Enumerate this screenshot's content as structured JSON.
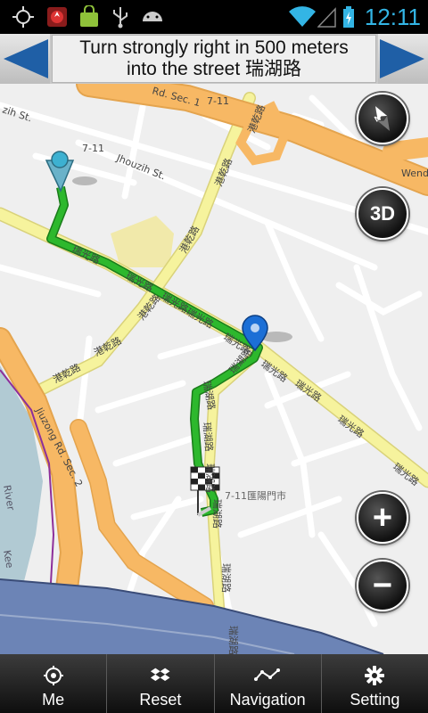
{
  "status_bar": {
    "clock": "12:11",
    "accent_color": "#33b5e5",
    "icons": [
      "gps-icon",
      "app-icon",
      "shopping-bag-icon",
      "usb-icon",
      "android-icon",
      "wifi-icon",
      "signal-icon",
      "battery-charging-icon"
    ]
  },
  "instruction": {
    "line1": "Turn strongly right in 500 meters",
    "line2": "into the street 瑞湖路"
  },
  "map": {
    "labels": {
      "rd_sec1": "Rd. Sec. 1",
      "seven_eleven_top": "7-11",
      "zih_st": "zih St.",
      "jhouzih_st": "Jhouzih St.",
      "seven_eleven_left": "7-11",
      "wende": "Wende",
      "gangqian_1": "港乾路",
      "gangqian_2": "港乾路",
      "gangqian_3": "港乾路",
      "gangqian_4": "港乾路",
      "gangqian_5": "港乾路",
      "ruiguang_1": "瑞光路",
      "ruiguang_2": "瑞光路",
      "ruiguang_3": "瑞光路",
      "ruiguang_4": "瑞光路",
      "ruiguang_5": "瑞光路",
      "ruiguang_6": "瑞光路",
      "ruiguang_7": "瑞光路",
      "ruiguang_8": "瑞光路",
      "ruiguang_9": "瑞光路",
      "ruihu_1": "瑞湖路",
      "ruihu_2": "瑞湖路",
      "ruihu_3": "瑞湖路",
      "ruihu_4": "瑞湖路",
      "ruihu_5": "瑞湖路",
      "ruihu_6": "瑞湖路",
      "ruihu_7": "瑞湖路",
      "jiuzong": "Jiuzong Rd. Sec. 2",
      "store": "7-11匯陽門市",
      "river": "River",
      "kee": "Kee"
    },
    "buttons": {
      "three_d": "3D",
      "zoom_in": "+",
      "zoom_out": "−"
    },
    "colors": {
      "route": "#2db82d",
      "major_road": "#f7b864",
      "secondary_road": "#f6f39d",
      "park": "#f1e9aa",
      "water": "#b1cad3",
      "highway": "#6c84b6",
      "marker": "#1c6fd6"
    }
  },
  "bottom_bar": {
    "tabs": [
      {
        "label": "Me",
        "icon": "crosshair-icon"
      },
      {
        "label": "Reset",
        "icon": "dropbox-icon"
      },
      {
        "label": "Navigation",
        "icon": "route-icon"
      },
      {
        "label": "Setting",
        "icon": "gear-icon"
      }
    ]
  }
}
